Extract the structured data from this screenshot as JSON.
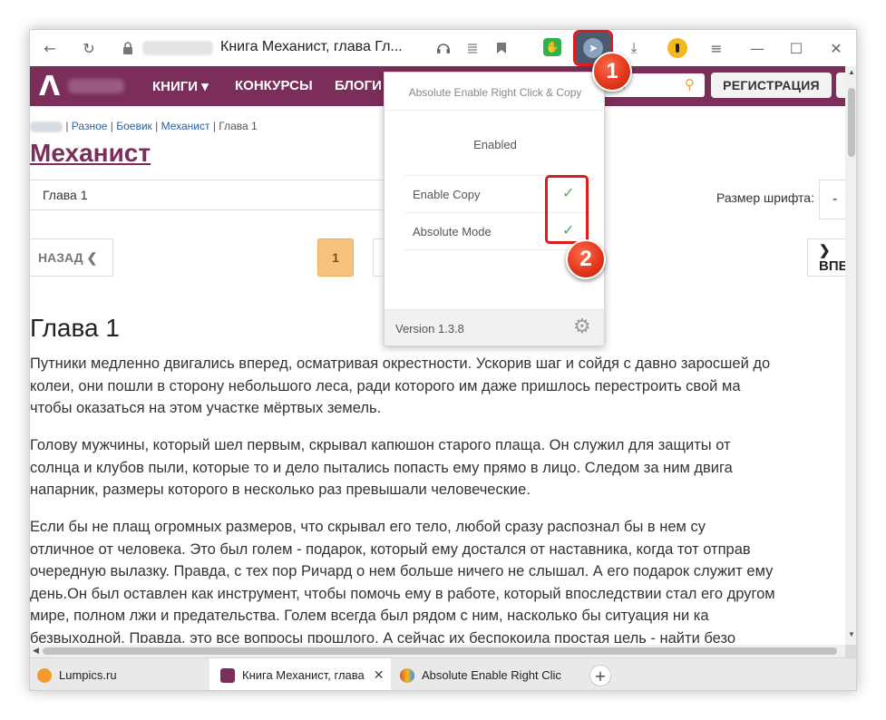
{
  "browser": {
    "page_title": "Книга Механист, глава Гл...",
    "lock_icon": "lock-icon",
    "window_controls": [
      "minimize",
      "maximize",
      "close"
    ],
    "icons": {
      "back": "←",
      "reload": "↻",
      "lock": "🔒",
      "headphones": "🎧",
      "reader": "≡",
      "bookmark": "▮",
      "green_ext": "✋",
      "ext_cursor": "➤",
      "download": "⤓",
      "yellow_ext": "●",
      "menu": "≡",
      "minimize": "—",
      "maximize": "☐",
      "close": "✕"
    }
  },
  "site": {
    "logo": "Λ",
    "nav": [
      "КНИГИ ▾",
      "КОНКУРСЫ",
      "БЛОГИ"
    ],
    "search_fragment": "ГИ",
    "search_icon": "⚲",
    "register_label": "РЕГИСТРАЦИЯ"
  },
  "breadcrumb": {
    "items": [
      "Разное",
      "Боевик",
      "Механист",
      "Глава 1"
    ],
    "sep": " | "
  },
  "book": {
    "title": "Механист",
    "chapter_select": "Глава 1",
    "font_size_label": "Размер шрифта:",
    "font_size_value": "-",
    "back_label": "НАЗАД ❮",
    "page_current": "1",
    "next_label": "❯ВПЕРЁД",
    "chapter_heading": "Глава 1"
  },
  "text": [
    [
      "Путники медленно двигались вперед, осматривая окрестности.  Ускорив шаг и сойдя с давно заросшей до",
      "колеи, они пошли в сторону небольшого леса, ради которого им даже пришлось перестроить свой ма",
      "чтобы оказаться на этом участке мёртвых земель."
    ],
    [
      "Голову мужчины, который шел первым, скрывал капюшон старого плаща. Он служил для защиты от",
      "солнца и клубов пыли, которые то и дело пытались попасть ему прямо в лицо. Следом за ним двига",
      "напарник, размеры которого в несколько раз превышали человеческие."
    ],
    [
      "Если бы не плащ огромных размеров, что скрывал его тело, любой сразу распознал бы в нем су",
      "отличное от человека. Это был голем - подарок, который ему достался от наставника, когда тот отправ",
      "очередную вылазку. Правда, с тех пор Ричард о нем больше ничего не слышал. А его подарок служит ему",
      "день.Он был оставлен как инструмент, чтобы помочь ему в работе, который впоследствии стал его другом",
      "мире, полном лжи и предательства. Голем всегда был рядом с ним, насколько бы ситуация ни ка",
      "безвыходной. Правда, это все вопросы прошлого. А сейчас их беспокоила простая цель - найти безо"
    ]
  ],
  "popup": {
    "title": "Absolute Enable Right Click & Copy",
    "status": "Enabled",
    "options": [
      {
        "label": "Enable Copy",
        "checked": "✓"
      },
      {
        "label": "Absolute Mode",
        "checked": "✓"
      }
    ],
    "version": "Version 1.3.8",
    "gear": "⚙"
  },
  "callouts": [
    "1",
    "2"
  ],
  "tabs": [
    {
      "label": "Lumpics.ru",
      "icon_color": "#f39c2b"
    },
    {
      "label": "Книга Механист, глава",
      "icon_color": "#7a2e59",
      "close": "✕"
    },
    {
      "label": "Absolute Enable Right Clic",
      "icon_color": "#e04e3a"
    }
  ],
  "new_tab": "+",
  "colors": {
    "brand": "#7a2e59",
    "accent": "#f6c27e",
    "check": "#55a85a",
    "callout": "#e0341b"
  }
}
